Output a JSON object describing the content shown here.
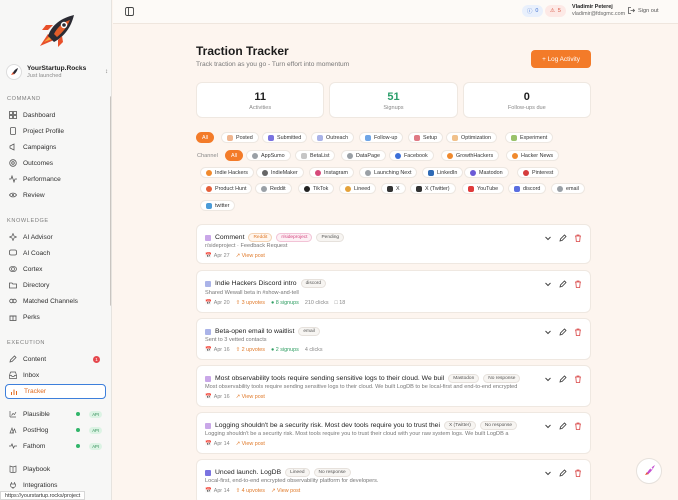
{
  "sidebar": {
    "project_name": "YourStartup.Rocks",
    "project_sub": "Just launched",
    "sections": {
      "command": "COMMAND",
      "knowledge": "KNOWLEDGE",
      "execution": "EXECUTION"
    },
    "command_items": [
      "Dashboard",
      "Project Profile",
      "Campaigns",
      "Outcomes",
      "Performance",
      "Review"
    ],
    "knowledge_items": [
      "AI Advisor",
      "AI Coach",
      "Cortex",
      "Directory",
      "Matched Channels",
      "Perks"
    ],
    "execution_items": [
      "Content",
      "Inbox",
      "Tracker"
    ],
    "content_badge": "1",
    "integrations": [
      {
        "label": "Plausible",
        "api": "API"
      },
      {
        "label": "PostHog",
        "api": "API"
      },
      {
        "label": "Fathom",
        "api": "API"
      }
    ],
    "bottom_items": [
      "Playbook",
      "Integrations"
    ],
    "status_url": "https://yourstartup.rocks/project"
  },
  "topbar": {
    "pill_blue": "0",
    "pill_red": "5",
    "user_name": "Vladimir Peterej",
    "user_email": "vladimir@fdsgmc.com",
    "signout": "Sign out"
  },
  "main": {
    "title": "Traction Tracker",
    "subtitle": "Track traction as you go - Turn effort into momentum",
    "log_button": "+ Log Activity",
    "stats": [
      {
        "num": "11",
        "label": "Activities"
      },
      {
        "num": "51",
        "label": "Signups"
      },
      {
        "num": "0",
        "label": "Follow-ups due"
      }
    ],
    "type_filters": [
      "All",
      "Posted",
      "Submitted",
      "Outreach",
      "Follow-up",
      "Setup",
      "Optimization",
      "Experiment"
    ],
    "channel_label": "Channel",
    "channel_filters_row1": [
      "All",
      "AppSumo",
      "BetaList",
      "DataPage",
      "Facebook",
      "GrowthHackers",
      "Hacker News"
    ],
    "channel_filters_row2": [
      "Indie Hackers",
      "IndieMaker",
      "Instagram",
      "Launching Next",
      "LinkedIn",
      "Mastodon",
      "Pinterest"
    ],
    "channel_filters_row3": [
      "Product Hunt",
      "Reddit",
      "TikTok",
      "Lineed",
      "X",
      "X (Twitter)",
      "YouTube",
      "discord",
      "email"
    ],
    "channel_filters_row4": [
      "twitter"
    ]
  },
  "cards": [
    {
      "title": "Comment",
      "tags": [
        "Reddit",
        "r/sideproject",
        "Pending"
      ],
      "desc": "r/sideproject · Feedback Request",
      "meta": [
        "Apr 27",
        "View post"
      ]
    },
    {
      "title": "Indie Hackers Discord intro",
      "tags": [
        "discord"
      ],
      "desc": "Shared Wewall beta in #show-and-tell",
      "meta": [
        "Apr 20",
        "3 upvotes",
        "8 signups",
        "210 clicks",
        "18"
      ]
    },
    {
      "title": "Beta-open email to waitlist",
      "tags": [
        "email"
      ],
      "desc": "Sent to 3 vetted contacts",
      "meta": [
        "Apr 16",
        "2 upvotes",
        "2 signups",
        "4 clicks"
      ]
    },
    {
      "title": "Most observability tools require sending sensitive logs to their cloud. We buil",
      "tags": [
        "Mastodon",
        "No response"
      ],
      "desc": "Most observability tools require sending sensitive logs to their cloud. We built LogDB to be local-first and end-to-end encrypted",
      "meta": [
        "Apr 16",
        "View post"
      ]
    },
    {
      "title": "Logging shouldn't be a security risk. Most dev tools require you to trust thei",
      "tags": [
        "X (Twitter)",
        "No response"
      ],
      "desc": "Logging shouldn't be a security risk. Most tools require you to trust their cloud with your raw system logs. We built LogDB a",
      "meta": [
        "Apr 14",
        "View post"
      ]
    },
    {
      "title": "Unced launch. LogDB",
      "tags": [
        "Lineed",
        "No response"
      ],
      "desc": "Local-first, end-to-end encrypted observability platform for developers.",
      "meta": [
        "Apr 14",
        "4 upvotes",
        "View post"
      ]
    }
  ]
}
